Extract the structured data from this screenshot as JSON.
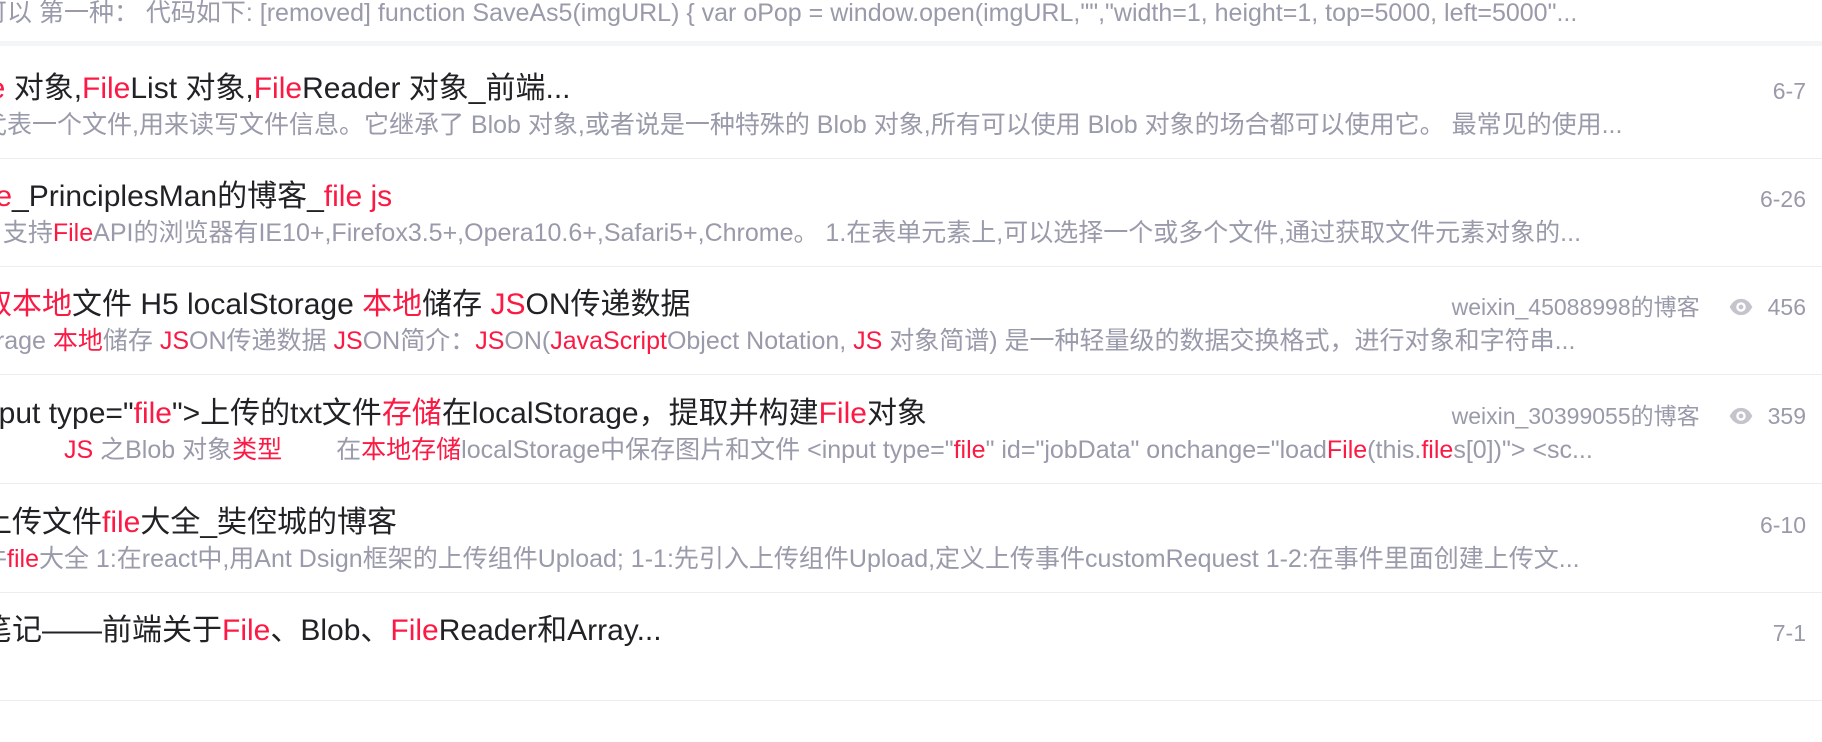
{
  "results": [
    {
      "desc": "可以 第一种： 代码如下: [removed] function SaveAs5(imgURL) { var oPop = window.open(imgURL,\"\",\"width=1, height=1, top=5000, left=5000\"..."
    },
    {
      "title_parts": [
        "le",
        " 对象,",
        "File",
        "List 对象,",
        "File",
        "Reader 对象_前端..."
      ],
      "date": "6-7",
      "desc": "弋表一个文件,用来读写文件信息。它继承了 Blob 对象,或者说是一种特殊的 Blob 对象,所有可以使用 Blob 对象的场合都可以使用它。 最常见的使用..."
    },
    {
      "title_parts": [
        "ile",
        "_PrinciplesMan的博客_",
        "file js"
      ],
      "date": "6-26",
      "desc_parts": [
        "e",
        " 支持",
        "File",
        "API的浏览器有IE10+,Firefox3.5+,Opera10.6+,Safari5+,Chrome。 1.在表单元素上,可以选择一个或多个文件,通过获取文件元素对象的..."
      ]
    },
    {
      "title_parts": [
        "取本地",
        "文件 H5 localStorage ",
        "本地",
        "储存 ",
        "JS",
        "ON传递数据"
      ],
      "author": "weixin_45088998的博客",
      "views": "456",
      "desc_parts": [
        "orage ",
        "本地",
        "储存 ",
        "JS",
        "ON传递数据 ",
        "JS",
        "ON简介：",
        "JS",
        "ON(",
        "JavaScript",
        "Object Notation, ",
        "JS",
        " 对象简谱) 是一种轻量级的数据交换格式，进行对象和字符串..."
      ]
    },
    {
      "title_parts": [
        "nput type=\"",
        "file",
        "\">上传的txt文件",
        "存储",
        "在localStorage，提取并构建",
        "File",
        "对象"
      ],
      "author": "weixin_30399055的博客",
      "views": "359",
      "desc_parts": [
        "JS",
        " 之Blob 对象",
        "类型",
        "在",
        "本地存储",
        "localStorage中保存图片和文件 <input type=\"",
        "file",
        "\" id=\"jobData\" onchange=\"load",
        "File",
        "(this.",
        "file",
        "s[0])\"> <sc..."
      ]
    },
    {
      "title_parts": [
        "上传文件",
        "file",
        "大全_奘倥城的博客"
      ],
      "date": "6-10",
      "desc_parts": [
        "件",
        "file",
        "大全 1:在react中,用Ant Dsign框架的上传组件Upload; 1-1:先引入上传组件Upload,定义上传事件customRequest 1-2:在事件里面创建上传文..."
      ]
    },
    {
      "title_parts": [
        "笔记——前端关于",
        "File",
        "、Blob、",
        "File",
        "Reader和Array..."
      ],
      "date": "7-1"
    }
  ],
  "icons": {
    "views": "eye-icon"
  },
  "colors": {
    "highlight": "#fc1944",
    "title": "#222226",
    "muted": "#999aaa",
    "divider": "#ededed"
  }
}
